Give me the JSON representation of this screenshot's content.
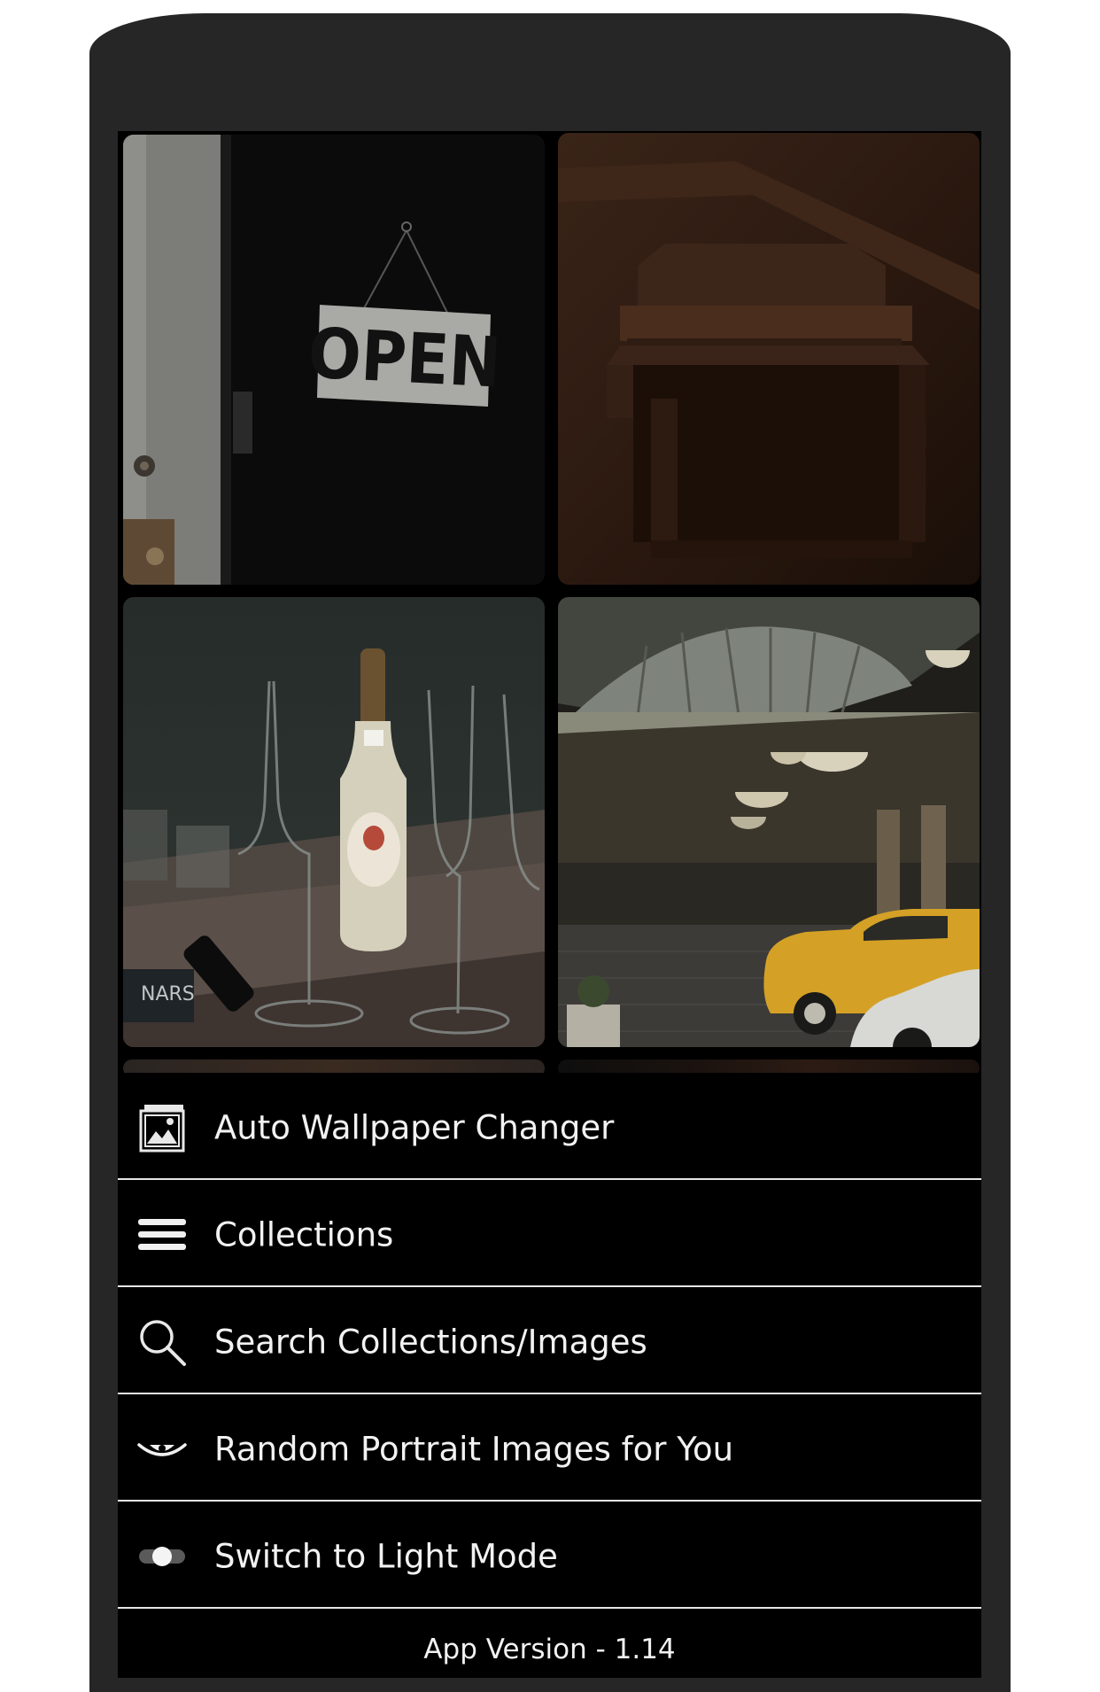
{
  "gallery": {
    "tiles": [
      {
        "name": "open-sign-door",
        "sign_text": "OPEN"
      },
      {
        "name": "brown-balcony"
      },
      {
        "name": "champagne-glasses",
        "brand_text": "NARS"
      },
      {
        "name": "dome-lobby-taxi"
      }
    ]
  },
  "menu": {
    "items": [
      {
        "label": "Auto Wallpaper Changer",
        "icon": "wallpaper-icon"
      },
      {
        "label": "Collections",
        "icon": "menu-lines-icon"
      },
      {
        "label": "Search Collections/Images",
        "icon": "search-icon"
      },
      {
        "label": "Random Portrait Images for You",
        "icon": "eye-icon"
      },
      {
        "label": "Switch to Light Mode",
        "icon": "toggle-icon"
      }
    ],
    "version": "App Version - 1.14"
  },
  "colors": {
    "background": "#000000",
    "frame": "#262626",
    "text": "#f2f2f2",
    "divider": "#e6e6e6"
  }
}
